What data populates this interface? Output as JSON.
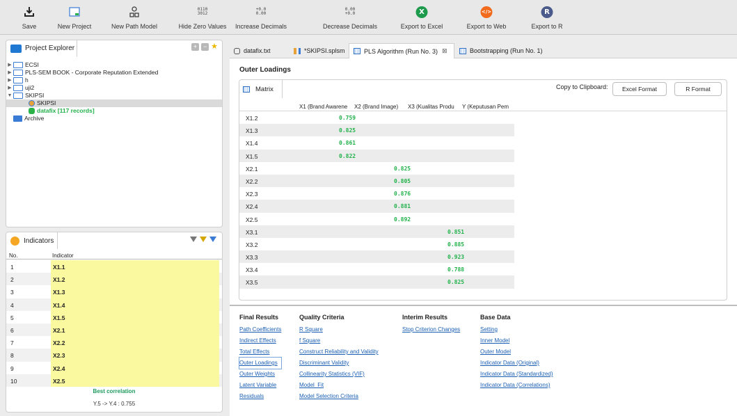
{
  "toolbar": {
    "buttons": [
      {
        "label": "Save",
        "icon": "download-icon"
      },
      {
        "label": "New Project",
        "icon": "new-project-icon"
      },
      {
        "label": "New Path Model",
        "icon": "path-model-icon"
      },
      {
        "label": "Hide Zero Values",
        "icon": "zero-values-icon",
        "digits": [
          "0110",
          "3012"
        ]
      },
      {
        "label": "Increase Decimals",
        "icon": "increase-decimals-icon",
        "digits": [
          "+0.0",
          "0.00"
        ]
      },
      {
        "label": "Decrease Decimals",
        "icon": "decrease-decimals-icon",
        "digits": [
          "0.00",
          "+0.0"
        ]
      },
      {
        "label": "Export to Excel",
        "icon": "excel-icon",
        "glyph": "X",
        "color": "#1d9a4b"
      },
      {
        "label": "Export to Web",
        "icon": "web-icon",
        "glyph": "</>",
        "color": "#f26a1b"
      },
      {
        "label": "Export to R",
        "icon": "r-icon",
        "glyph": "R",
        "color": "#4a5a8a"
      }
    ]
  },
  "project_explorer": {
    "title": "Project Explorer",
    "tree": [
      {
        "label": "ECSI",
        "expanded": false
      },
      {
        "label": "PLS-SEM BOOK - Corporate Reputation Extended",
        "expanded": false
      },
      {
        "label": "h",
        "expanded": false
      },
      {
        "label": "uji2",
        "expanded": false
      },
      {
        "label": "SKIPSI",
        "expanded": true
      },
      {
        "label": "SKIPSI",
        "child": true,
        "selected": true
      },
      {
        "label": "datafix [117 records]",
        "child": true,
        "green": true
      },
      {
        "label": "Archive"
      }
    ]
  },
  "indicators": {
    "title": "Indicators",
    "col_no": "No.",
    "col_indicator": "Indicator",
    "rows": [
      {
        "no": "1",
        "name": "X1.1"
      },
      {
        "no": "2",
        "name": "X1.2"
      },
      {
        "no": "3",
        "name": "X1.3"
      },
      {
        "no": "4",
        "name": "X1.4"
      },
      {
        "no": "5",
        "name": "X1.5"
      },
      {
        "no": "6",
        "name": "X2.1"
      },
      {
        "no": "7",
        "name": "X2.2"
      },
      {
        "no": "8",
        "name": "X2.3"
      },
      {
        "no": "9",
        "name": "X2.4"
      },
      {
        "no": "10",
        "name": "X2.5"
      }
    ],
    "best_title": "Best correlation",
    "best_value": "Y.5 -> Y.4 : 0.755"
  },
  "editor_tabs": [
    {
      "label": "datafix.txt"
    },
    {
      "label": "*SKIPSI.splsm"
    },
    {
      "label": "PLS Algorithm (Run No. 3)",
      "active": true,
      "close": "⊠"
    },
    {
      "label": "Bootstrapping (Run No. 1)"
    }
  ],
  "outer_loadings": {
    "title": "Outer Loadings",
    "matrix_tab": "Matrix",
    "copy_label": "Copy to Clipboard:",
    "excel_btn": "Excel Format",
    "r_btn": "R Format",
    "columns": [
      "X1 (Brand Awarene",
      "X2 (Brand Image)",
      "X3 (Kualitas Produ",
      "Y (Keputusan Pem"
    ],
    "rows": [
      {
        "label": "X1.2",
        "col": 0,
        "value": "0.759"
      },
      {
        "label": "X1.3",
        "col": 0,
        "value": "0.825"
      },
      {
        "label": "X1.4",
        "col": 0,
        "value": "0.861"
      },
      {
        "label": "X1.5",
        "col": 0,
        "value": "0.822"
      },
      {
        "label": "X2.1",
        "col": 1,
        "value": "0.825"
      },
      {
        "label": "X2.2",
        "col": 1,
        "value": "0.805"
      },
      {
        "label": "X2.3",
        "col": 1,
        "value": "0.876"
      },
      {
        "label": "X2.4",
        "col": 1,
        "value": "0.881"
      },
      {
        "label": "X2.5",
        "col": 1,
        "value": "0.892"
      },
      {
        "label": "X3.1",
        "col": 2,
        "value": "0.851"
      },
      {
        "label": "X3.2",
        "col": 2,
        "value": "0.885"
      },
      {
        "label": "X3.3",
        "col": 2,
        "value": "0.923"
      },
      {
        "label": "X3.4",
        "col": 2,
        "value": "0.788"
      },
      {
        "label": "X3.5",
        "col": 2,
        "value": "0.825"
      }
    ]
  },
  "results": {
    "final": {
      "title": "Final Results",
      "links": [
        "Path Coefficients",
        "Indirect Effects",
        "Total Effects",
        "Outer Loadings",
        "Outer Weights",
        "Latent Variable",
        "Residuals"
      ]
    },
    "quality": {
      "title": "Quality Criteria",
      "links": [
        "R Square",
        "f Square",
        "Construct Reliability and Validity",
        "Discriminant Validity",
        "Collinearity Statistics (VIF)",
        "Model_Fit",
        "Model Selection Criteria"
      ]
    },
    "interim": {
      "title": "Interim Results",
      "links": [
        "Stop Criterion Changes"
      ]
    },
    "base": {
      "title": "Base Data",
      "links": [
        "Setting",
        "Inner Model",
        "Outer Model",
        "Indicator Data (Original)",
        "Indicator Data (Standardized)",
        "Indicator Data (Correlations)"
      ]
    }
  }
}
